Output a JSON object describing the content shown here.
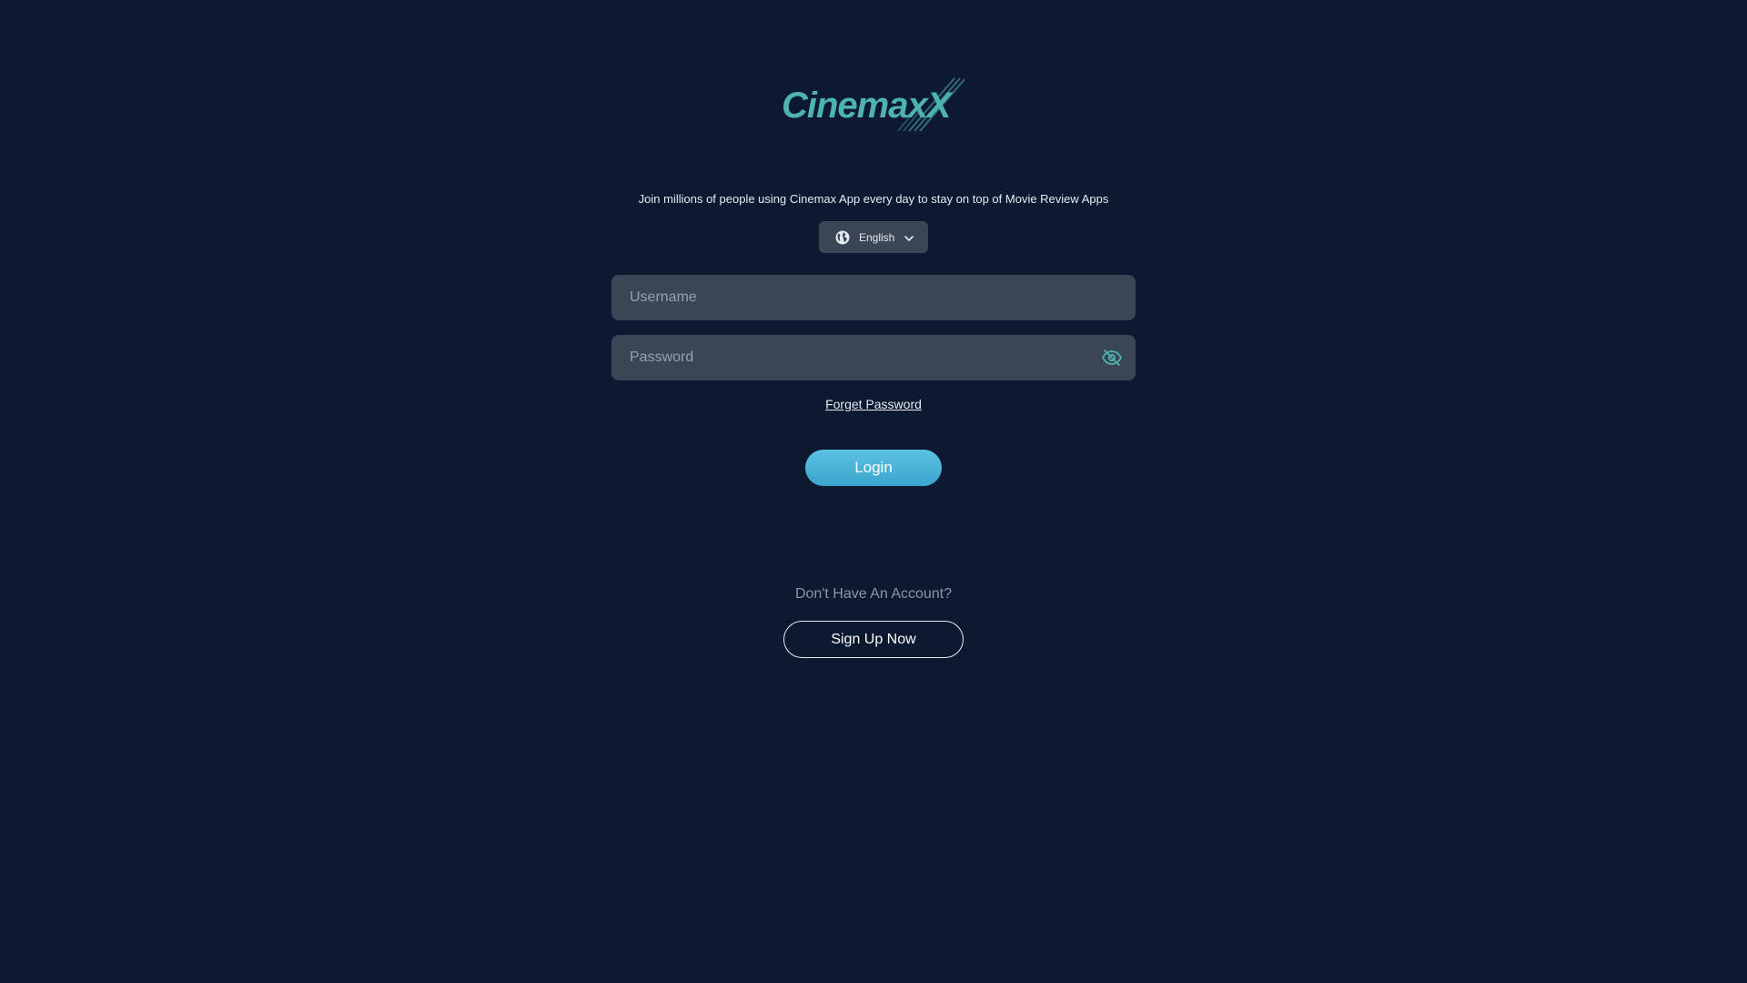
{
  "brand": {
    "logo_text": "CinemaxX",
    "accent_color": "#4fb3ad"
  },
  "tagline": "Join millions of people using Cinemax App every day to stay on top of Movie Review Apps",
  "language": {
    "icon": "globe-icon",
    "selected": "English",
    "dropdown_icon": "chevron-down-icon"
  },
  "form": {
    "username": {
      "placeholder": "Username",
      "value": ""
    },
    "password": {
      "placeholder": "Password",
      "value": "",
      "toggle_icon": "eye-off-icon"
    },
    "forgot_password_label": "Forget Password",
    "login_label": "Login"
  },
  "signup": {
    "prompt": "Don't Have An Account?",
    "button_label": "Sign Up Now"
  },
  "colors": {
    "background": "#0d1930",
    "input_bg": "#3a4555",
    "login_button": "#4bb3da",
    "muted_text": "#8a96a4"
  }
}
